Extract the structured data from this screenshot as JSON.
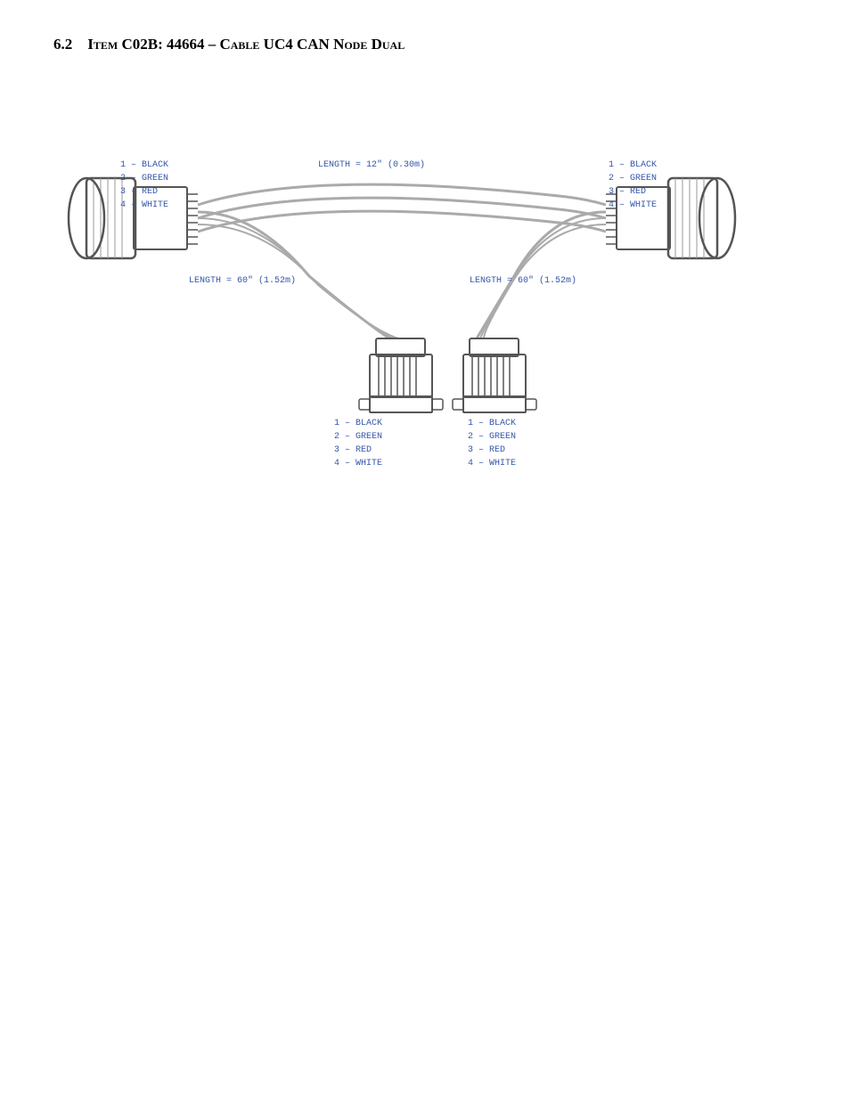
{
  "section": {
    "number": "6.2",
    "title": "Item C02B: 44664 – Cable UC4 CAN Node Dual"
  },
  "diagram": {
    "length_top": "LENGTH = 12\" (0.30m)",
    "length_left": "LENGTH = 60\" (1.52m)",
    "length_right": "LENGTH = 60\" (1.52m)",
    "left_connector_labels": [
      "1 – BLACK",
      "2 – GREEN",
      "3 – RED",
      "4 – WHITE"
    ],
    "right_connector_labels": [
      "1 – BLACK",
      "2 – GREEN",
      "3 – RED",
      "4 – WHITE"
    ],
    "bottom_left_labels": [
      "1 – BLACK",
      "2 – GREEN",
      "3 – RED",
      "4 – WHITE"
    ],
    "bottom_right_labels": [
      "1 – BLACK",
      "2 – GREEN",
      "3 – RED",
      "4 – WHITE"
    ]
  }
}
